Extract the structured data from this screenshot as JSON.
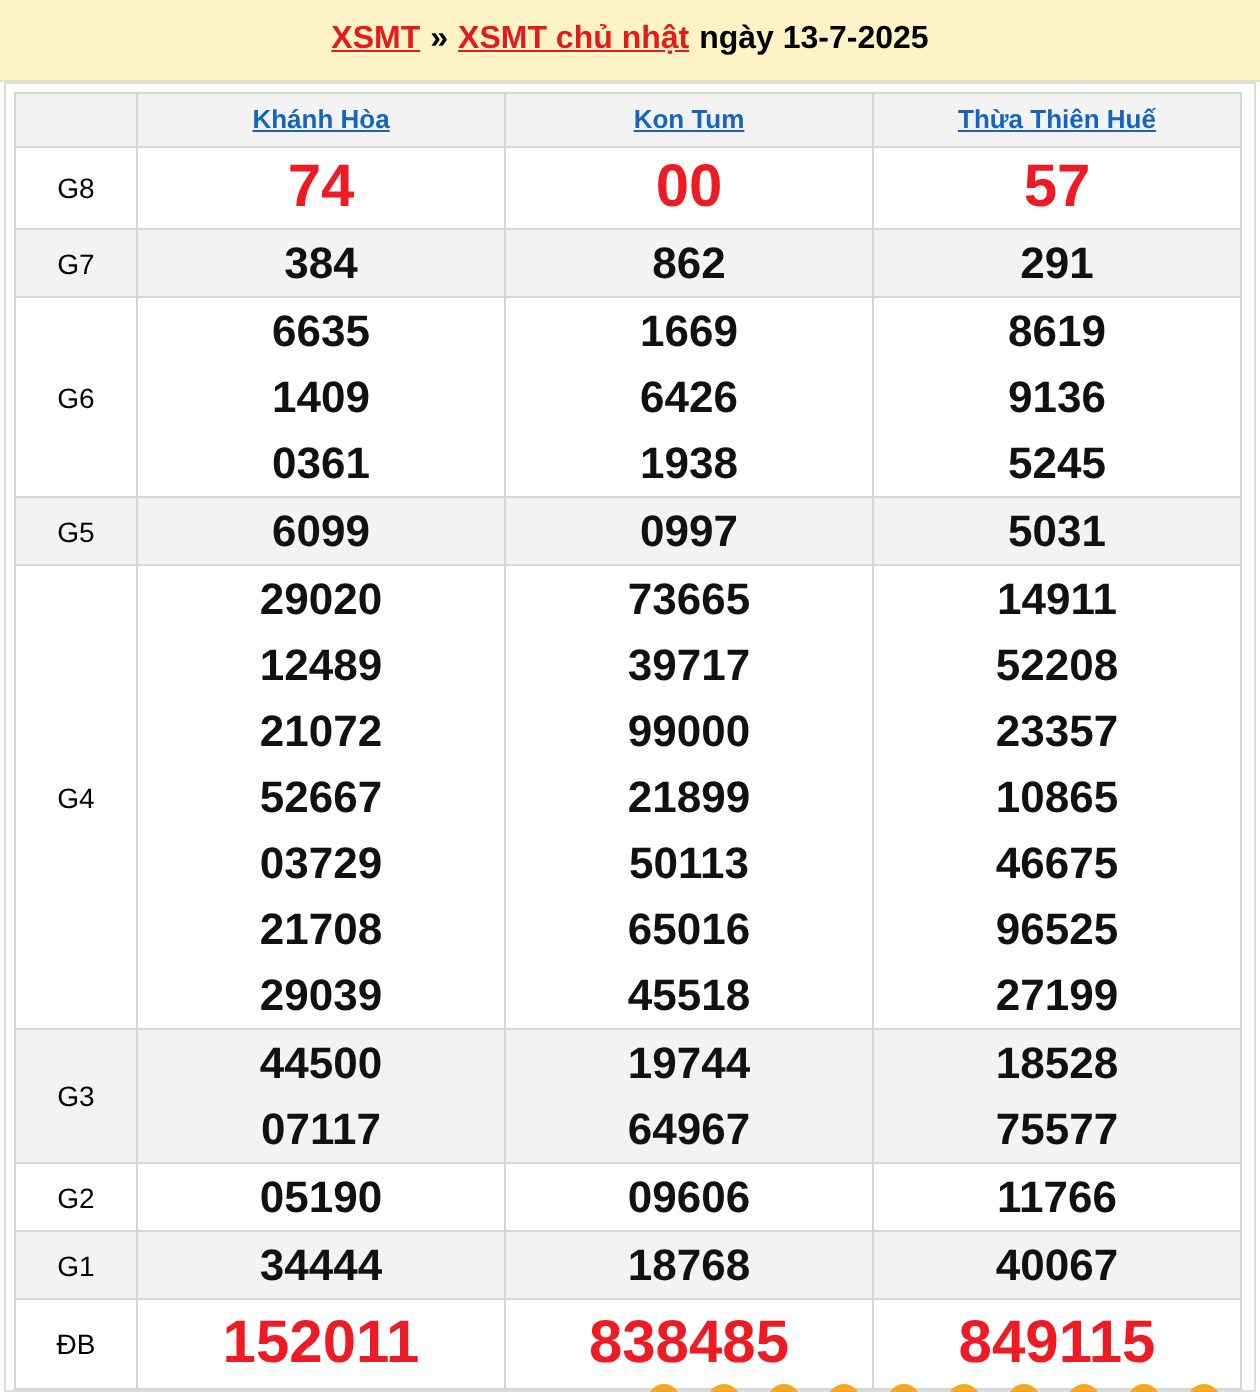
{
  "title": {
    "link_1": "XSMT",
    "separator": "»",
    "link_2": "XSMT chủ nhật",
    "date": "ngày 13-7-2025"
  },
  "provinces": [
    "Khánh Hòa",
    "Kon Tum",
    "Thừa Thiên Huế"
  ],
  "rows": [
    {
      "prize": "G8",
      "kind": "big",
      "shaded": false,
      "values": [
        [
          "74"
        ],
        [
          "00"
        ],
        [
          "57"
        ]
      ]
    },
    {
      "prize": "G7",
      "kind": "normal",
      "shaded": true,
      "values": [
        [
          "384"
        ],
        [
          "862"
        ],
        [
          "291"
        ]
      ]
    },
    {
      "prize": "G6",
      "kind": "normal",
      "shaded": false,
      "values": [
        [
          "6635",
          "1409",
          "0361"
        ],
        [
          "1669",
          "6426",
          "1938"
        ],
        [
          "8619",
          "9136",
          "5245"
        ]
      ]
    },
    {
      "prize": "G5",
      "kind": "normal",
      "shaded": true,
      "values": [
        [
          "6099"
        ],
        [
          "0997"
        ],
        [
          "5031"
        ]
      ]
    },
    {
      "prize": "G4",
      "kind": "normal",
      "shaded": false,
      "values": [
        [
          "29020",
          "12489",
          "21072",
          "52667",
          "03729",
          "21708",
          "29039"
        ],
        [
          "73665",
          "39717",
          "99000",
          "21899",
          "50113",
          "65016",
          "45518"
        ],
        [
          "14911",
          "52208",
          "23357",
          "10865",
          "46675",
          "96525",
          "27199"
        ]
      ]
    },
    {
      "prize": "G3",
      "kind": "normal",
      "shaded": true,
      "values": [
        [
          "44500",
          "07117"
        ],
        [
          "19744",
          "64967"
        ],
        [
          "18528",
          "75577"
        ]
      ]
    },
    {
      "prize": "G2",
      "kind": "normal",
      "shaded": false,
      "values": [
        [
          "05190"
        ],
        [
          "09606"
        ],
        [
          "11766"
        ]
      ]
    },
    {
      "prize": "G1",
      "kind": "normal",
      "shaded": true,
      "values": [
        [
          "34444"
        ],
        [
          "18768"
        ],
        [
          "40067"
        ]
      ]
    },
    {
      "prize": "ĐB",
      "kind": "big",
      "shaded": false,
      "values": [
        [
          "152011"
        ],
        [
          "838485"
        ],
        [
          "849115"
        ]
      ]
    }
  ]
}
